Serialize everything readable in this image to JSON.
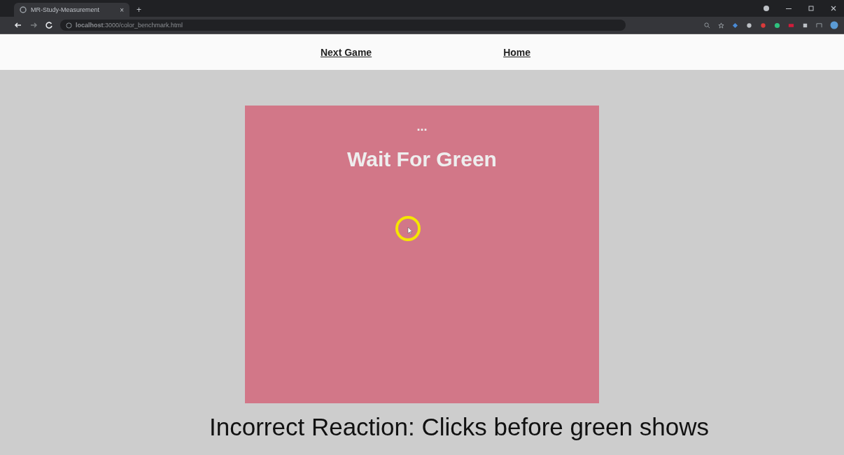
{
  "browser": {
    "tab_title": "MR-Study-Measurement",
    "tab_close": "×",
    "new_tab": "+",
    "address": "**localhost**:3000/color_benchmark.html"
  },
  "nav": {
    "links": [
      "Next Game",
      "Home"
    ]
  },
  "game": {
    "indicator": "...",
    "message": "Wait For Green"
  },
  "caption": "Incorrect Reaction: Clicks before green shows"
}
